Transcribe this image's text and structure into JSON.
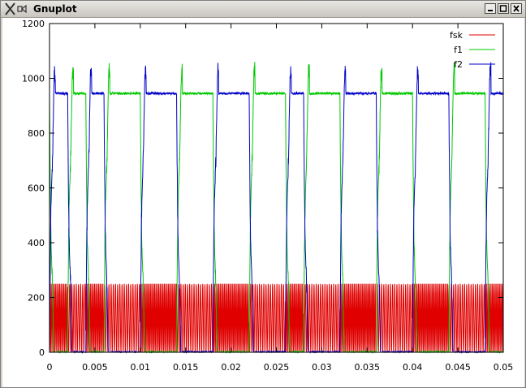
{
  "window": {
    "title": "Gnuplot"
  },
  "icons": {
    "app": "x-logo-icon",
    "minimize": "minimize-icon",
    "maximize": "maximize-icon",
    "close": "close-icon"
  },
  "colors": {
    "fsk": "#e00000",
    "f1": "#00c800",
    "f2": "#0000c8"
  },
  "chart_data": {
    "type": "line",
    "xlim": [
      0,
      0.05
    ],
    "ylim": [
      0,
      1200
    ],
    "xticks": [
      "0",
      "0.005",
      "0.01",
      "0.015",
      "0.02",
      "0.025",
      "0.03",
      "0.035",
      "0.04",
      "0.045",
      "0.05"
    ],
    "yticks": [
      "0",
      "200",
      "400",
      "600",
      "800",
      "1000",
      "1200"
    ],
    "grid": false,
    "legend_position": "top-right",
    "bits": [
      1,
      0,
      1,
      0,
      0,
      1,
      1,
      0,
      0,
      1,
      1,
      0,
      0,
      1,
      0,
      0,
      1,
      1,
      0,
      0,
      1,
      1,
      0,
      0,
      1
    ],
    "series": [
      {
        "name": "fsk",
        "description_level": "oscillating between 0 and 250 throughout",
        "values": {
          "min": 0,
          "max": 250,
          "cycles_per_sec": 5200
        }
      },
      {
        "name": "f1",
        "values": {
          "high": 945,
          "low": 0,
          "peaks": [
            1075,
            1020,
            1020,
            980,
            1020,
            985
          ]
        }
      },
      {
        "name": "f2",
        "values": {
          "high": 945,
          "low": 0,
          "peak": 975
        }
      }
    ]
  }
}
